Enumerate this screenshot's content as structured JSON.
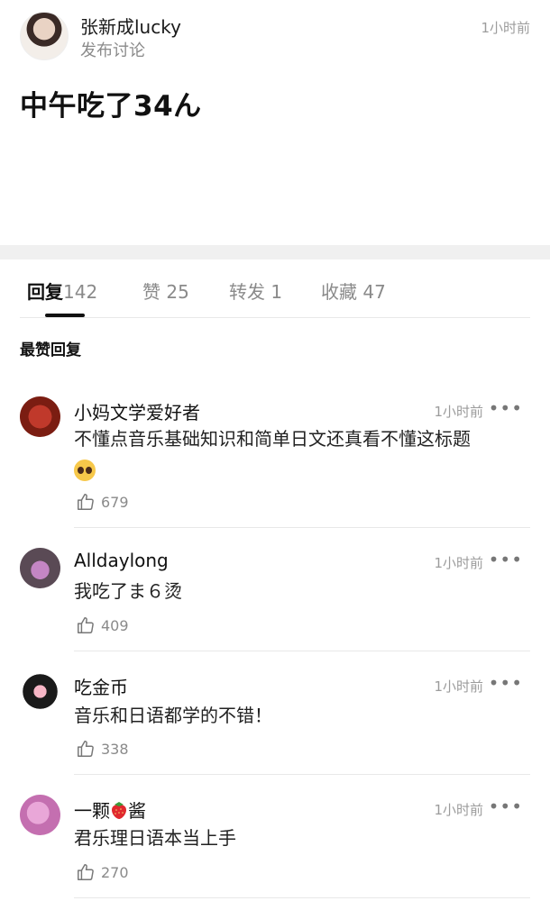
{
  "post": {
    "author": "张新成lucky",
    "subtitle": "发布讨论",
    "time": "1小时前",
    "body": "中午吃了34ん"
  },
  "tabs": [
    {
      "label": "回复",
      "count": "142"
    },
    {
      "label": "赞",
      "count": "25"
    },
    {
      "label": "转发",
      "count": "1"
    },
    {
      "label": "收藏",
      "count": "47"
    }
  ],
  "section_title": "最赞回复",
  "comments": [
    {
      "name": "小妈文学爱好者",
      "time": "1小时前",
      "more": "•••",
      "text": "不懂点音乐基础知识和简单日文还真看不懂这标题",
      "emoji": "pleading-face-icon",
      "likes": "679"
    },
    {
      "name": "Alldaylong",
      "time": "1小时前",
      "more": "•••",
      "text": "我吃了ま６烫",
      "likes": "409"
    },
    {
      "name": "吃金币",
      "time": "1小时前",
      "more": "•••",
      "text": "音乐和日语都学的不错！",
      "likes": "338"
    },
    {
      "name_prefix": "一颗",
      "name_suffix": "酱",
      "name_icon": "strawberry-icon",
      "time": "1小时前",
      "more": "•••",
      "text": "君乐理日语本当上手",
      "likes": "270"
    }
  ]
}
